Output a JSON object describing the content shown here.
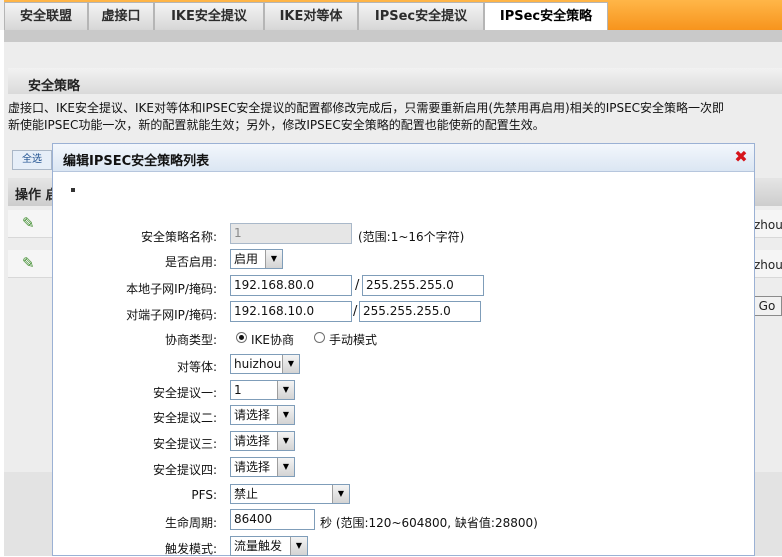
{
  "tabs": [
    {
      "label": "安全联盟",
      "active": false
    },
    {
      "label": "虚接口",
      "active": false
    },
    {
      "label": "IKE安全提议",
      "active": false
    },
    {
      "label": "IKE对等体",
      "active": false
    },
    {
      "label": "IPSec安全提议",
      "active": false
    },
    {
      "label": "IPSec安全策略",
      "active": true
    }
  ],
  "background": {
    "section_title": "安全策略",
    "notice_line1": "虚接口、IKE安全提议、IKE对等体和IPSEC安全提议的配置都修改完成后，只需要重新启用(先禁用再启用)相关的IPSEC安全策略一次即",
    "notice_line2": "新使能IPSEC功能一次，新的配置就能生效；另外，修改IPSEC安全策略的配置也能使新的配置生效。",
    "select_all": "全选",
    "op_header": "操作 启",
    "rows": [
      {
        "right_text": "zhou"
      },
      {
        "right_text": "zhou"
      }
    ],
    "go_button": "Go"
  },
  "dialog": {
    "title": "编辑IPSEC安全策略列表",
    "close_icon": "close-icon",
    "form": {
      "policy_name": {
        "label": "安全策略名称:",
        "value": "1",
        "hint": "(范围:1~16个字符)"
      },
      "enabled": {
        "label": "是否启用:",
        "value": "启用"
      },
      "local_subnet": {
        "label": "本地子网IP/掩码:",
        "ip": "192.168.80.0",
        "sep": "/",
        "mask": "255.255.255.0"
      },
      "remote_subnet": {
        "label": "对端子网IP/掩码:",
        "ip": "192.168.10.0",
        "sep": "/",
        "mask": "255.255.255.0"
      },
      "negotiation": {
        "label": "协商类型:",
        "option_ike": "IKE协商",
        "option_manual": "手动模式",
        "selected": "IKE协商"
      },
      "peer": {
        "label": "对等体:",
        "value": "huizhou"
      },
      "proposal1": {
        "label": "安全提议一:",
        "value": "1"
      },
      "proposal2": {
        "label": "安全提议二:",
        "value": "请选择"
      },
      "proposal3": {
        "label": "安全提议三:",
        "value": "请选择"
      },
      "proposal4": {
        "label": "安全提议四:",
        "value": "请选择"
      },
      "pfs": {
        "label": "PFS:",
        "value": "禁止"
      },
      "lifetime": {
        "label": "生命周期:",
        "value": "86400",
        "hint": "秒 (范围:120~604800, 缺省值:28800)"
      },
      "trigger": {
        "label": "触发模式:",
        "value": "流量触发"
      }
    }
  },
  "colors": {
    "tab_bar": "#f7941d",
    "close": "#d6141b",
    "pencil": "#3d8c2c"
  }
}
